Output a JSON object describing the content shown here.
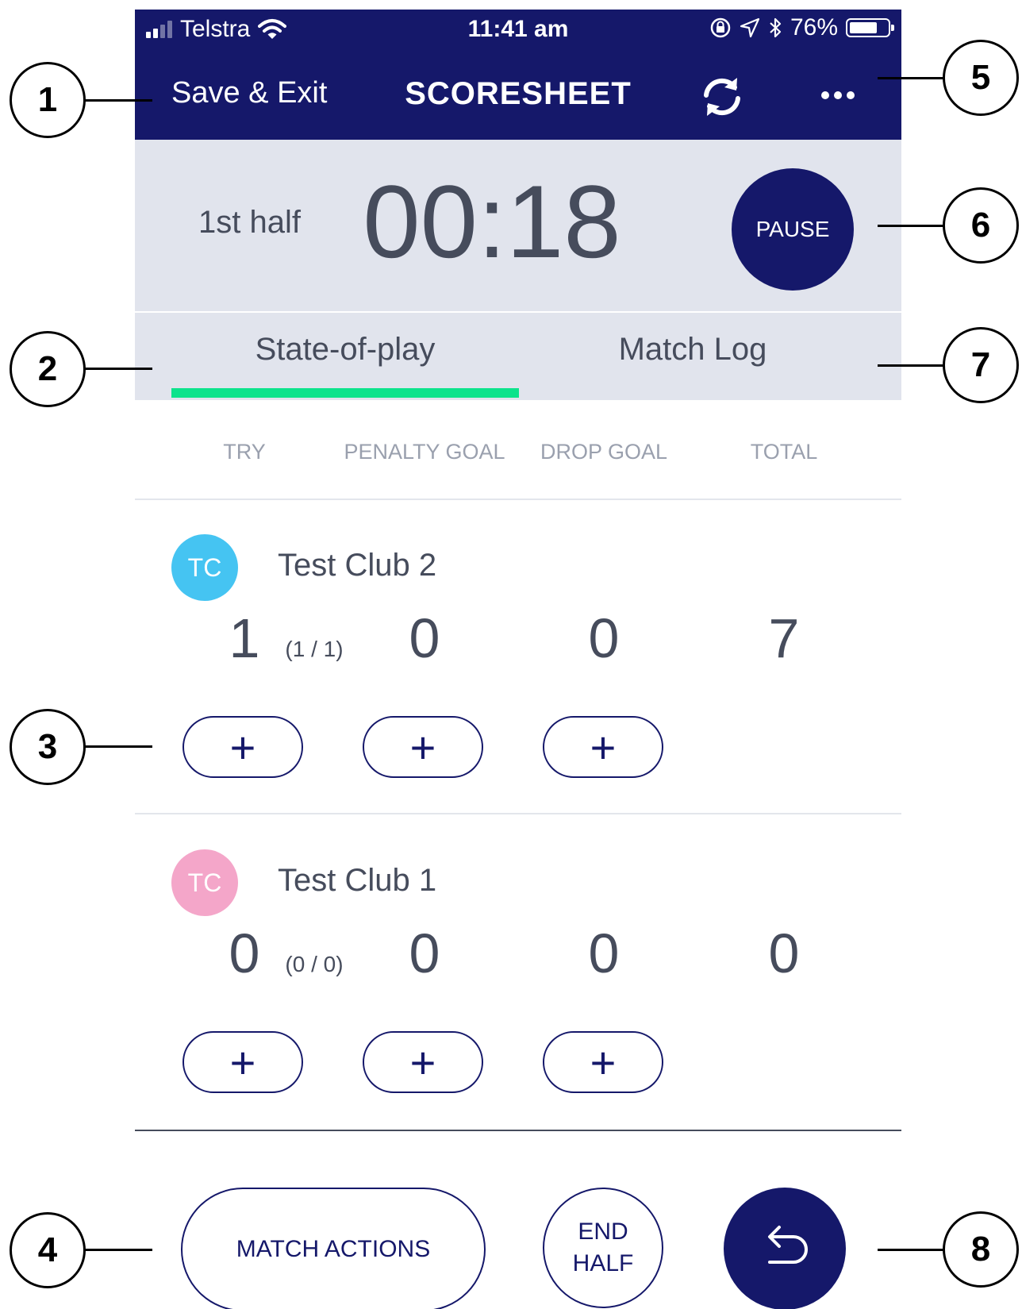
{
  "status_bar": {
    "carrier": "Telstra",
    "time": "11:41 am",
    "battery": "76%",
    "battery_level": 0.76
  },
  "navbar": {
    "save_exit_label": "Save & Exit",
    "title": "SCORESHEET",
    "sync_icon": "sync-icon",
    "more_icon": "more-icon"
  },
  "timer": {
    "period": "1st half",
    "clock": "00:18",
    "pause_label": "PAUSE"
  },
  "tabs": [
    {
      "label": "State-of-play",
      "active": true
    },
    {
      "label": "Match Log",
      "active": false
    }
  ],
  "columns": [
    "TRY",
    "PENALTY GOAL",
    "DROP GOAL",
    "TOTAL"
  ],
  "teams": [
    {
      "initials": "TC",
      "color": "#45c4f2",
      "name": "Test Club 2",
      "try": "1",
      "conversions": "(1 / 1)",
      "penalty_goal": "0",
      "drop_goal": "0",
      "total": "7"
    },
    {
      "initials": "TC",
      "color": "#f4a6c9",
      "name": "Test Club 1",
      "try": "0",
      "conversions": "(0 / 0)",
      "penalty_goal": "0",
      "drop_goal": "0",
      "total": "0"
    }
  ],
  "plus_label": "+",
  "footer": {
    "match_actions_label": "MATCH ACTIONS",
    "end_half_line1": "END",
    "end_half_line2": "HALF",
    "undo_icon": "undo-icon"
  },
  "callouts": [
    "1",
    "2",
    "3",
    "4",
    "5",
    "6",
    "7",
    "8"
  ],
  "colors": {
    "navy": "#15186a",
    "panel": "#e1e4ed",
    "accent_green": "#0de38c",
    "text_gray": "#464c5c"
  }
}
